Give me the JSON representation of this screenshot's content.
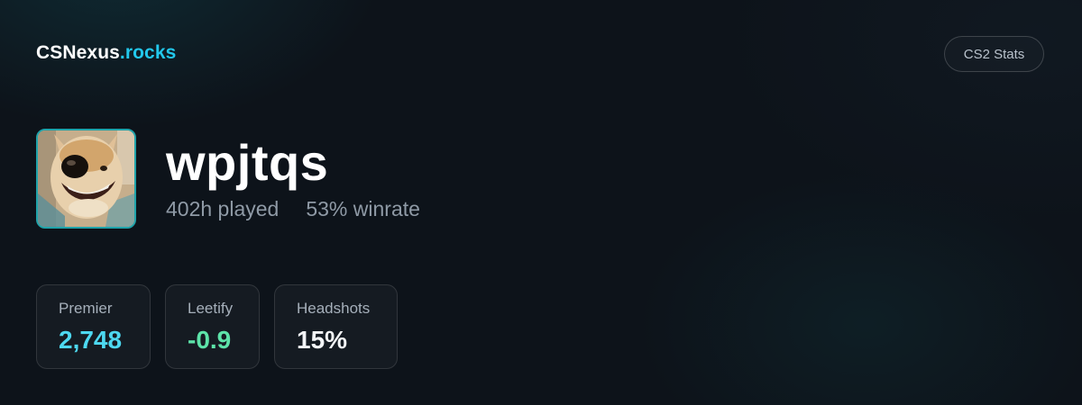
{
  "brand": {
    "name": "CSNexus",
    "tld": ".rocks"
  },
  "header": {
    "badge_label": "CS2 Stats"
  },
  "profile": {
    "avatar_icon": "dog-avatar-photo",
    "username": "wpjtqs",
    "hours_played": "402h played",
    "winrate": "53% winrate"
  },
  "stats": [
    {
      "label": "Premier",
      "value": "2,748",
      "color": "#4dd8f0"
    },
    {
      "label": "Leetify",
      "value": "-0.9",
      "color": "#5de3a9"
    },
    {
      "label": "Headshots",
      "value": "15%",
      "color": "#f2f4f6"
    }
  ],
  "colors": {
    "accent": "#22c8ec",
    "avatar_border": "#1fa3aa",
    "background": "#0d131a"
  }
}
